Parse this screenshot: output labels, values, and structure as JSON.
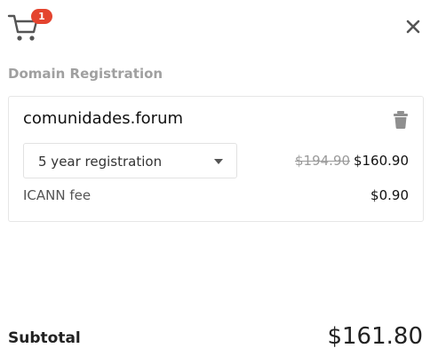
{
  "header": {
    "cart_icon": "shopping-cart-icon",
    "cart_count": "1",
    "close_icon": "close-icon"
  },
  "section": {
    "title": "Domain Registration"
  },
  "item": {
    "domain": "comunidades.forum",
    "delete_icon": "trash-icon",
    "term_selected": "5 year registration",
    "original_price": "$194.90",
    "price": "$160.90",
    "fee_label": "ICANN fee",
    "fee_value": "$0.90"
  },
  "summary": {
    "subtotal_label": "Subtotal",
    "subtotal_value": "$161.80"
  },
  "colors": {
    "badge": "#e4442f",
    "muted_text": "#a0a0a0",
    "border": "#e6e6e6"
  }
}
